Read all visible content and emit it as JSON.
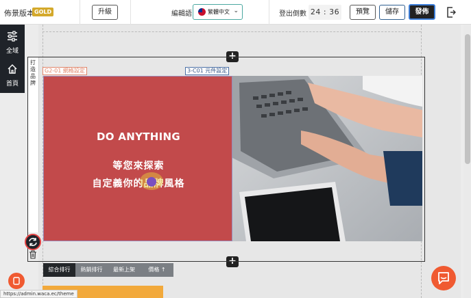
{
  "topbar": {
    "plan_label": "佈景版本",
    "plan_badge": "GOLD",
    "upgrade_label": "升級",
    "edit_language_label": "編輯語系",
    "help_icon": "question-circle-icon",
    "language_value": "繁體中文",
    "logout_countdown_label": "登出倒數",
    "countdown": "24 : 36",
    "preview_label": "預覽",
    "save_label": "儲存",
    "publish_label": "發佈",
    "exit_icon": "logout-icon"
  },
  "sidebar": {
    "items": [
      {
        "label": "全域",
        "icon": "sliders-icon"
      },
      {
        "label": "首頁",
        "icon": "home-icon"
      }
    ]
  },
  "editor": {
    "brand_tab": "打造品牌",
    "grid_tag": "G2-01 網格設定",
    "component_tag": "3-C01 元件設定",
    "headline": "DO ANYTHING",
    "subline1": "等您來探索",
    "subline2": "自定義你的品牌風格",
    "add_symbol": "+"
  },
  "product_tabs": [
    "綜合排行",
    "熱銷排行",
    "最新上架",
    "價格 ↑"
  ],
  "status_url": "https://admin.waca.ec/theme",
  "colors": {
    "accent_red": "#c24a4b",
    "publish_bg": "#222222",
    "chat_orange": "#f05a31",
    "gold": "#d4a92b",
    "teal": "#4aa8a0"
  }
}
